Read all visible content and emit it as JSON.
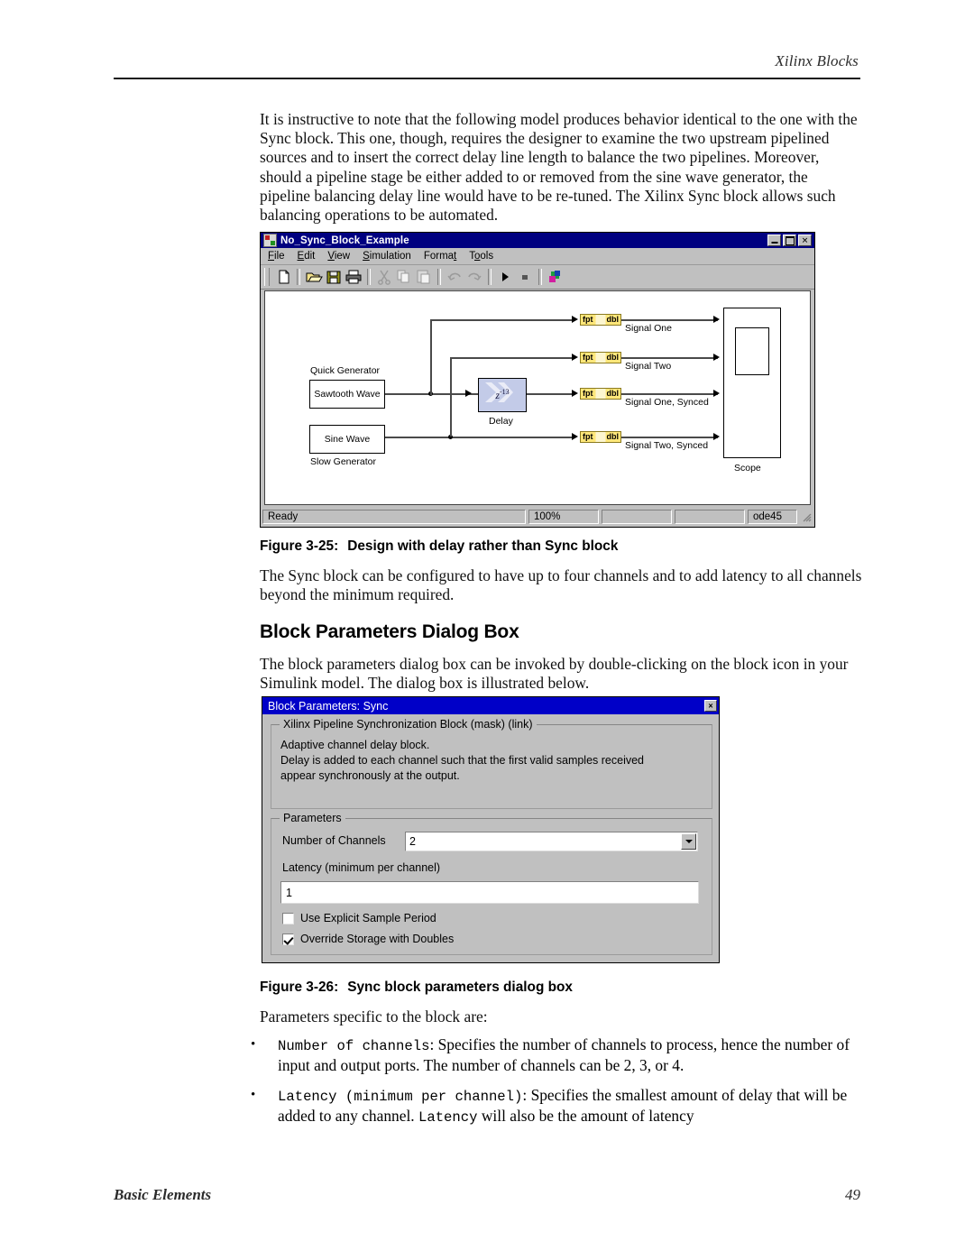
{
  "page": {
    "running_head": "Xilinx Blocks",
    "footer_left": "Basic Elements",
    "footer_page": "49"
  },
  "intro_paragraph": "It is instructive to note that the following model produces behavior identical to the one with the Sync block. This one, though, requires the designer to examine the two upstream pipelined sources and to insert the correct delay line length to balance the two pipelines. Moreover, should a pipeline stage be either added to or removed from the sine wave generator, the pipeline balancing delay line would have to be re-tuned. The Xilinx Sync block allows such balancing operations to be automated.",
  "figure_3_25": {
    "caption_number": "Figure 3-25:",
    "caption_text": "Design with delay rather than Sync block",
    "window": {
      "title": "No_Sync_Block_Example",
      "title_icon": "simulink-model-icon",
      "window_buttons": [
        "minimize",
        "maximize",
        "close"
      ],
      "menus": [
        "File",
        "Edit",
        "View",
        "Simulation",
        "Format",
        "Tools"
      ],
      "toolbar_icons": [
        "new-file-icon",
        "open-folder-icon",
        "save-disk-icon",
        "print-icon",
        "cut-scissors-icon",
        "copy-icon",
        "paste-icon",
        "undo-icon",
        "redo-icon",
        "start-simulation-icon",
        "stop-simulation-icon",
        "xilinx-blockset-icon"
      ],
      "statusbar": {
        "status": "Ready",
        "zoom": "100%",
        "field3": "",
        "field4": "",
        "solver": "ode45"
      },
      "diagram": {
        "source_blocks": [
          {
            "annotation": "Quick Generator",
            "label": "Sawtooth Wave"
          },
          {
            "annotation": "Slow Generator",
            "label": "Sine Wave"
          }
        ],
        "delay_block": {
          "label": "Delay",
          "icon_text": "z",
          "icon_exponent": "-13"
        },
        "gateways": [
          {
            "left": "fpt",
            "right": "dbl",
            "signal": "Signal One"
          },
          {
            "left": "fpt",
            "right": "dbl",
            "signal": "Signal Two"
          },
          {
            "left": "fpt",
            "right": "dbl",
            "signal": "Signal One, Synced"
          },
          {
            "left": "fpt",
            "right": "dbl",
            "signal": "Signal Two, Synced"
          }
        ],
        "scope": {
          "label": "Scope"
        }
      }
    }
  },
  "mid_paragraph": "The Sync block can be configured to have up to four channels and to add latency to all channels beyond the minimum required.",
  "section_heading": "Block Parameters Dialog Box",
  "dialog_intro_paragraph": "The block parameters dialog box can be invoked by double-clicking on the block icon in your Simulink model. The dialog box is illustrated below.",
  "figure_3_26": {
    "caption_number": "Figure 3-26:",
    "caption_text": "Sync block parameters dialog box",
    "dialog": {
      "title": "Block Parameters: Sync",
      "close_glyph": "×",
      "mask_group_label": "Xilinx Pipeline Synchronization Block (mask) (link)",
      "mask_description_lines": [
        "Adaptive channel delay block.",
        "Delay is added to each channel such that the first valid samples received",
        "appear synchronously at the output."
      ],
      "parameters_group_label": "Parameters",
      "number_of_channels_label": "Number of Channels",
      "number_of_channels_value": "2",
      "number_of_channels_options": [
        "2",
        "3",
        "4"
      ],
      "latency_label": "Latency  (minimum per channel)",
      "latency_value": "1",
      "use_explicit_sample_period_label": "Use Explicit Sample Period",
      "use_explicit_sample_period_checked": false,
      "override_storage_with_doubles_label": "Override Storage with Doubles",
      "override_storage_with_doubles_checked": true
    }
  },
  "params_intro": "Parameters specific to the block are:",
  "bullets": [
    {
      "mono": "Number of channels",
      "rest": ": Specifies the number of channels to process, hence the number of input and output ports. The number of channels can be 2, 3, or 4."
    },
    {
      "mono": "Latency (minimum per channel)",
      "rest": ": Specifies the smallest amount of delay that will be added to any channel. ",
      "mono2": "Latency",
      "rest2": " will also be the amount of latency"
    }
  ],
  "colors": {
    "titlebar_blue": "#000080",
    "dialog_titlebar_blue": "#0000c8",
    "chrome_gray": "#c0c0c0",
    "gateway_yellow": "#ffe77a",
    "delay_block_blue": "#c3cbe8"
  }
}
